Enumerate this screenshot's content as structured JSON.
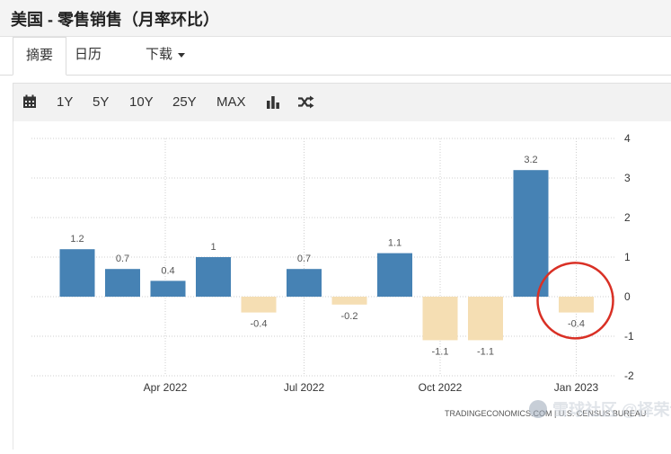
{
  "header": {
    "title": "美国 - 零售销售（月率环比）"
  },
  "tabs": [
    {
      "label": "摘要"
    },
    {
      "label": "日历"
    },
    {
      "label": "下载"
    }
  ],
  "toolbar": {
    "icons": [
      "calendar-icon",
      "bar-chart-icon",
      "shuffle-icon"
    ],
    "ranges": [
      "1Y",
      "5Y",
      "10Y",
      "25Y",
      "MAX"
    ]
  },
  "colors": {
    "positive": "#4682b4",
    "negative": "#f5deb3",
    "highlight": "#d93025"
  },
  "chart_data": {
    "type": "bar",
    "categories": [
      "2022-02",
      "2022-03",
      "2022-04",
      "2022-05",
      "2022-06",
      "2022-07",
      "2022-08",
      "2022-09",
      "2022-10",
      "2022-11",
      "2022-12",
      "2023-01"
    ],
    "values": [
      1.2,
      0.7,
      0.4,
      1,
      -0.4,
      0.7,
      -0.2,
      1.1,
      -1.1,
      -1.1,
      3.2,
      -0.4
    ],
    "value_labels": [
      "1.2",
      "0.7",
      "0.4",
      "1",
      "-0.4",
      "0.7",
      "-0.2",
      "1.1",
      "-1.1",
      "-1.1",
      "3.2",
      "-0.4"
    ],
    "x_tick_labels": [
      "Apr 2022",
      "Jul 2022",
      "Oct 2022",
      "Jan 2023"
    ],
    "y_tick_labels": [
      "4",
      "3",
      "2",
      "1",
      "0",
      "-1",
      "-2"
    ],
    "ylim": [
      -2,
      4
    ],
    "y_axis_side": "right",
    "grid": true,
    "grid_style": "dotted",
    "highlight": {
      "category": "2023-01",
      "shape": "circle"
    },
    "source": "TRADINGECONOMICS.COM | U.S. CENSUS BUREAU"
  },
  "watermark": {
    "text": "雪球社区 @择荣谋士"
  }
}
